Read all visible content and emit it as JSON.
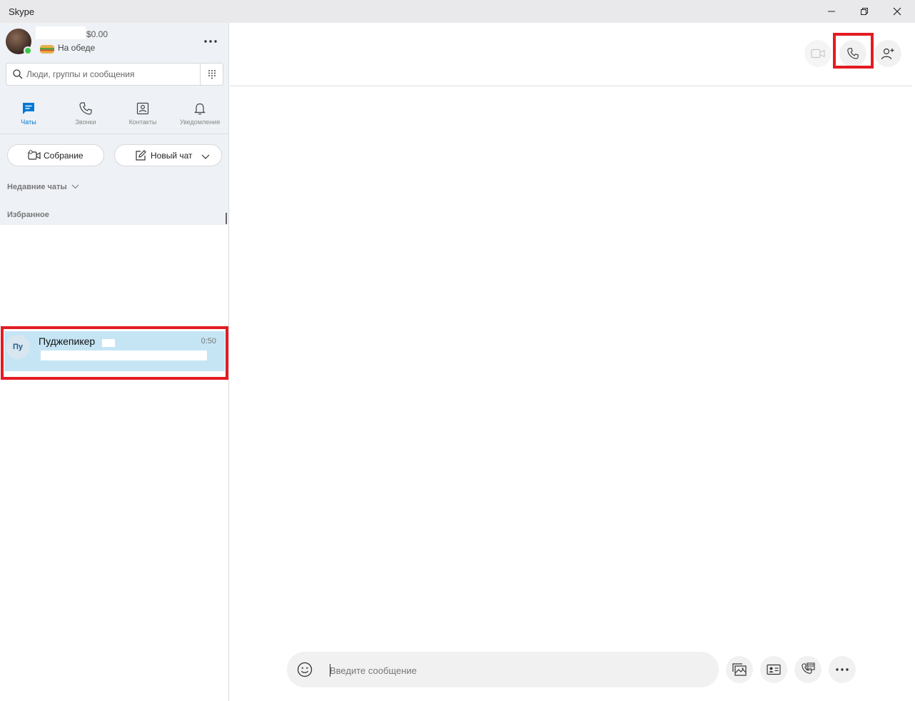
{
  "window": {
    "title": "Skype",
    "minimize_glyph": "─",
    "close_glyph": "✕"
  },
  "profile": {
    "balance": "$0.00",
    "mood": "На обеде"
  },
  "search": {
    "placeholder": "Люди, группы и сообщения"
  },
  "tabs": [
    {
      "label": "Чаты",
      "icon": "chat-icon",
      "active": true
    },
    {
      "label": "Звонки",
      "icon": "phone-icon",
      "active": false
    },
    {
      "label": "Контакты",
      "icon": "contacts-icon",
      "active": false
    },
    {
      "label": "Уведомления",
      "icon": "bell-icon",
      "active": false
    }
  ],
  "actions": {
    "meeting_label": "Собрание",
    "new_chat_label": "Новый чат"
  },
  "sections": {
    "recent_label": "Недавние чаты",
    "favorites_label": "Избранное"
  },
  "chats": [
    {
      "initials": "Пу",
      "name": "Пуджепикер",
      "time": "0:50"
    }
  ],
  "compose": {
    "placeholder": "Введите сообщение"
  },
  "colors": {
    "accent": "#0078d4",
    "highlight": "#e31b23",
    "selected_chat": "#c5e5f5",
    "online": "#38c94a"
  }
}
